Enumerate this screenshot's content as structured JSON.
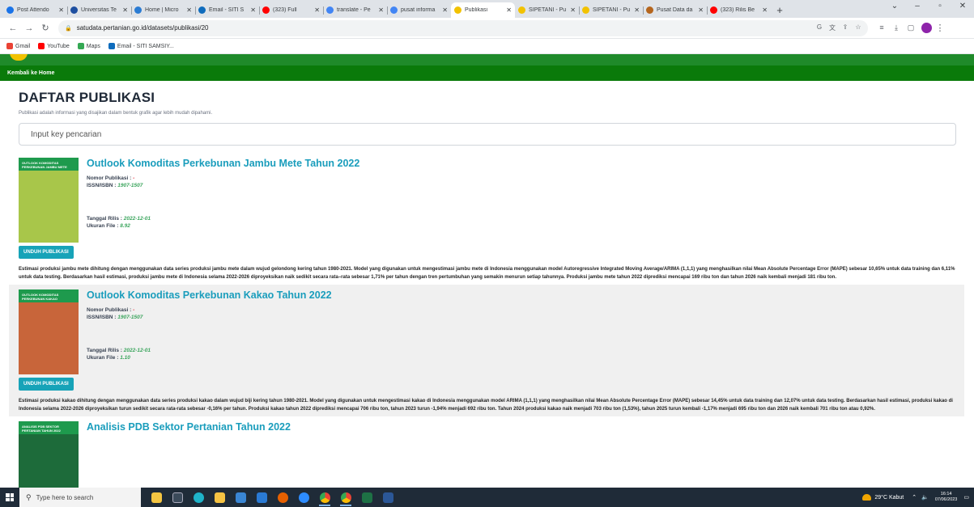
{
  "browser": {
    "tabs": [
      {
        "label": "Post Attendo",
        "color": "#1a73e8"
      },
      {
        "label": "Universitas Te",
        "color": "#1e4fa0"
      },
      {
        "label": "Home | Micro",
        "color": "#2b7cd3"
      },
      {
        "label": "Email - SITI S",
        "color": "#0f6cbd"
      },
      {
        "label": "(323) Full",
        "color": "#ff0000"
      },
      {
        "label": "translate - Pe",
        "color": "#4285f4"
      },
      {
        "label": "pusat informa",
        "color": "#4285f4"
      },
      {
        "label": "Publikasi",
        "color": "#f2c200"
      },
      {
        "label": "SIPETANI - Pu",
        "color": "#f2c200"
      },
      {
        "label": "SIPETANI - Pu",
        "color": "#f2c200"
      },
      {
        "label": "Pusat Data da",
        "color": "#b5651d"
      },
      {
        "label": "(323) Rilis Be",
        "color": "#ff0000"
      }
    ],
    "active_tab_index": 7,
    "url": "satudata.pertanian.go.id/datasets/publikasi/20",
    "bookmarks": [
      {
        "label": "Gmail",
        "color": "#ea4335"
      },
      {
        "label": "YouTube",
        "color": "#ff0000"
      },
      {
        "label": "Maps",
        "color": "#34a853"
      },
      {
        "label": "Email - SITI SAMSIY...",
        "color": "#0f6cbd"
      }
    ]
  },
  "page": {
    "home_link": "Kembali ke Home",
    "title": "DAFTAR PUBLIKASI",
    "subtitle": "Publikasi adalah informasi yang disajikan dalam bentuk grafik agar lebih mudah dipahami.",
    "search_placeholder": "Input key pencarian",
    "labels": {
      "nomor": "Nomor Publikasi :",
      "issn": "ISSN/ISBN :",
      "tanggal": "Tanggal Rilis :",
      "ukuran": "Ukuran File :",
      "download": "UNDUH PUBLIKASI"
    },
    "publications": [
      {
        "title": "Outlook Komoditas Perkebunan Jambu Mete Tahun 2022",
        "cover_text": "OUTLOOK KOMODITAS PERKEBUNAN JAMBU METE",
        "cover_color": "#a8c64a",
        "nomor": "-",
        "issn": "1907-1507",
        "tanggal": "2022-12-01",
        "ukuran": "8.92",
        "abstract": "Estimasi produksi jambu mete dihitung dengan menggunakan data series produksi jambu mete dalam wujud gelondong kering tahun 1980-2021. Model yang digunakan untuk mengestimasi jambu mete di Indonesia menggunakan model Autoregressive Integrated Moving Average/ARIMA (1,1,1) yang menghasilkan nilai Mean Absolute Percentage Error (MAPE) sebesar 10,65% untuk data training dan 6,11% untuk data testing. Berdasarkan hasil estimasi, produksi jambu mete di Indonesia selama 2022-2026 diproyeksikan naik sedikit secara rata–rata sebesar 1,71% per tahun dengan tren pertumbuhan yang semakin menurun setiap tahunnya. Produksi jambu mete tahun 2022 diprediksi mencapai 169 ribu ton dan tahun 2026 naik kembali menjadi 181 ribu ton."
      },
      {
        "title": "Outlook Komoditas Perkebunan Kakao Tahun 2022",
        "cover_text": "OUTLOOK KOMODITAS PERKEBUNAN KAKAO",
        "cover_color": "#c8653a",
        "nomor": "-",
        "issn": "1907-1507",
        "tanggal": "2022-12-01",
        "ukuran": "1.10",
        "abstract": "Estimasi produksi kakao dihitung dengan menggunakan data series produksi kakao dalam wujud biji kering tahun 1980-2021. Model yang digunakan untuk mengestimasi kakao di Indonesia menggunakan model ARIMA (1,1,1) yang menghasilkan nilai Mean Absolute Percentage Error (MAPE) sebesar 14,45% untuk data training dan 12,07% untuk data testing. Berdasarkan hasil estimasi, produksi kakao di Indonesia selama 2022-2026 diproyeksikan turun sedikit secara rata-rata sebesar -0,16% per tahun. Produksi kakao tahun 2022 diprediksi mencapai 706 ribu ton, tahun 2023 turun -1,94% menjadi 692 ribu ton. Tahun 2024 produksi kakao naik menjadi 703 ribu ton (1,53%), tahun 2025 turun kembali -1,17% menjadi 695 ribu ton dan 2026 naik kembali 701 ribu ton atau 0,92%."
      },
      {
        "title": "Analisis PDB Sektor Pertanian Tahun 2022",
        "cover_text": "ANALISIS PDB SEKTOR PERTANIAN TAHUN 2022",
        "cover_color": "#1d6b3a"
      }
    ]
  },
  "taskbar": {
    "search_placeholder": "Type here to search",
    "weather": "29°C  Kabut",
    "time": "16:14",
    "date": "07/06/2023"
  }
}
